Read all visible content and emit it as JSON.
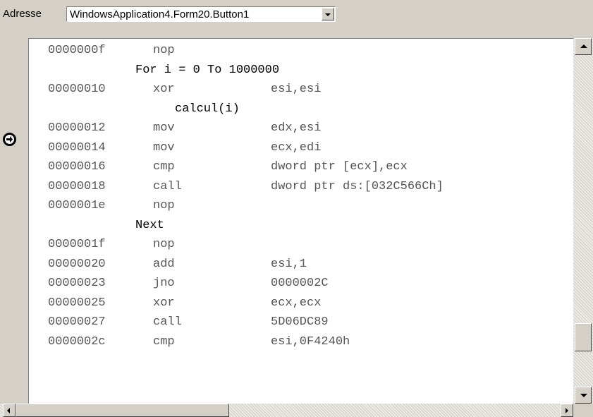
{
  "address_bar": {
    "label": "Adresse",
    "value": "WindowsApplication4.Form20.Button1"
  },
  "gutter": {
    "current_line_icon": "arrow-right-circle-icon"
  },
  "code": {
    "lines": [
      {
        "kind": "asm",
        "address": "0000000f",
        "op": "nop",
        "args": ""
      },
      {
        "kind": "src",
        "text": "For i = 0 To 1000000"
      },
      {
        "kind": "asm",
        "address": "00000010",
        "op": "xor",
        "args": "esi,esi"
      },
      {
        "kind": "src",
        "text": "calcul(i)"
      },
      {
        "kind": "asm",
        "address": "00000012",
        "op": "mov",
        "args": "edx,esi",
        "current": true
      },
      {
        "kind": "asm",
        "address": "00000014",
        "op": "mov",
        "args": "ecx,edi"
      },
      {
        "kind": "asm",
        "address": "00000016",
        "op": "cmp",
        "args": "dword ptr [ecx],ecx"
      },
      {
        "kind": "asm",
        "address": "00000018",
        "op": "call",
        "args": "dword ptr ds:[032C566Ch]"
      },
      {
        "kind": "asm",
        "address": "0000001e",
        "op": "nop",
        "args": ""
      },
      {
        "kind": "src",
        "text": "Next"
      },
      {
        "kind": "asm",
        "address": "0000001f",
        "op": "nop",
        "args": ""
      },
      {
        "kind": "asm",
        "address": "00000020",
        "op": "add",
        "args": "esi,1"
      },
      {
        "kind": "asm",
        "address": "00000023",
        "op": "jno",
        "args": "0000002C"
      },
      {
        "kind": "asm",
        "address": "00000025",
        "op": "xor",
        "args": "ecx,ecx"
      },
      {
        "kind": "asm",
        "address": "00000027",
        "op": "call",
        "args": "5D06DC89"
      },
      {
        "kind": "asm",
        "address": "0000002c",
        "op": "cmp",
        "args": "esi,0F4240h"
      }
    ]
  },
  "colors": {
    "chrome": "#d4d0c8",
    "asm_text": "#555555",
    "source_text": "#000000"
  }
}
